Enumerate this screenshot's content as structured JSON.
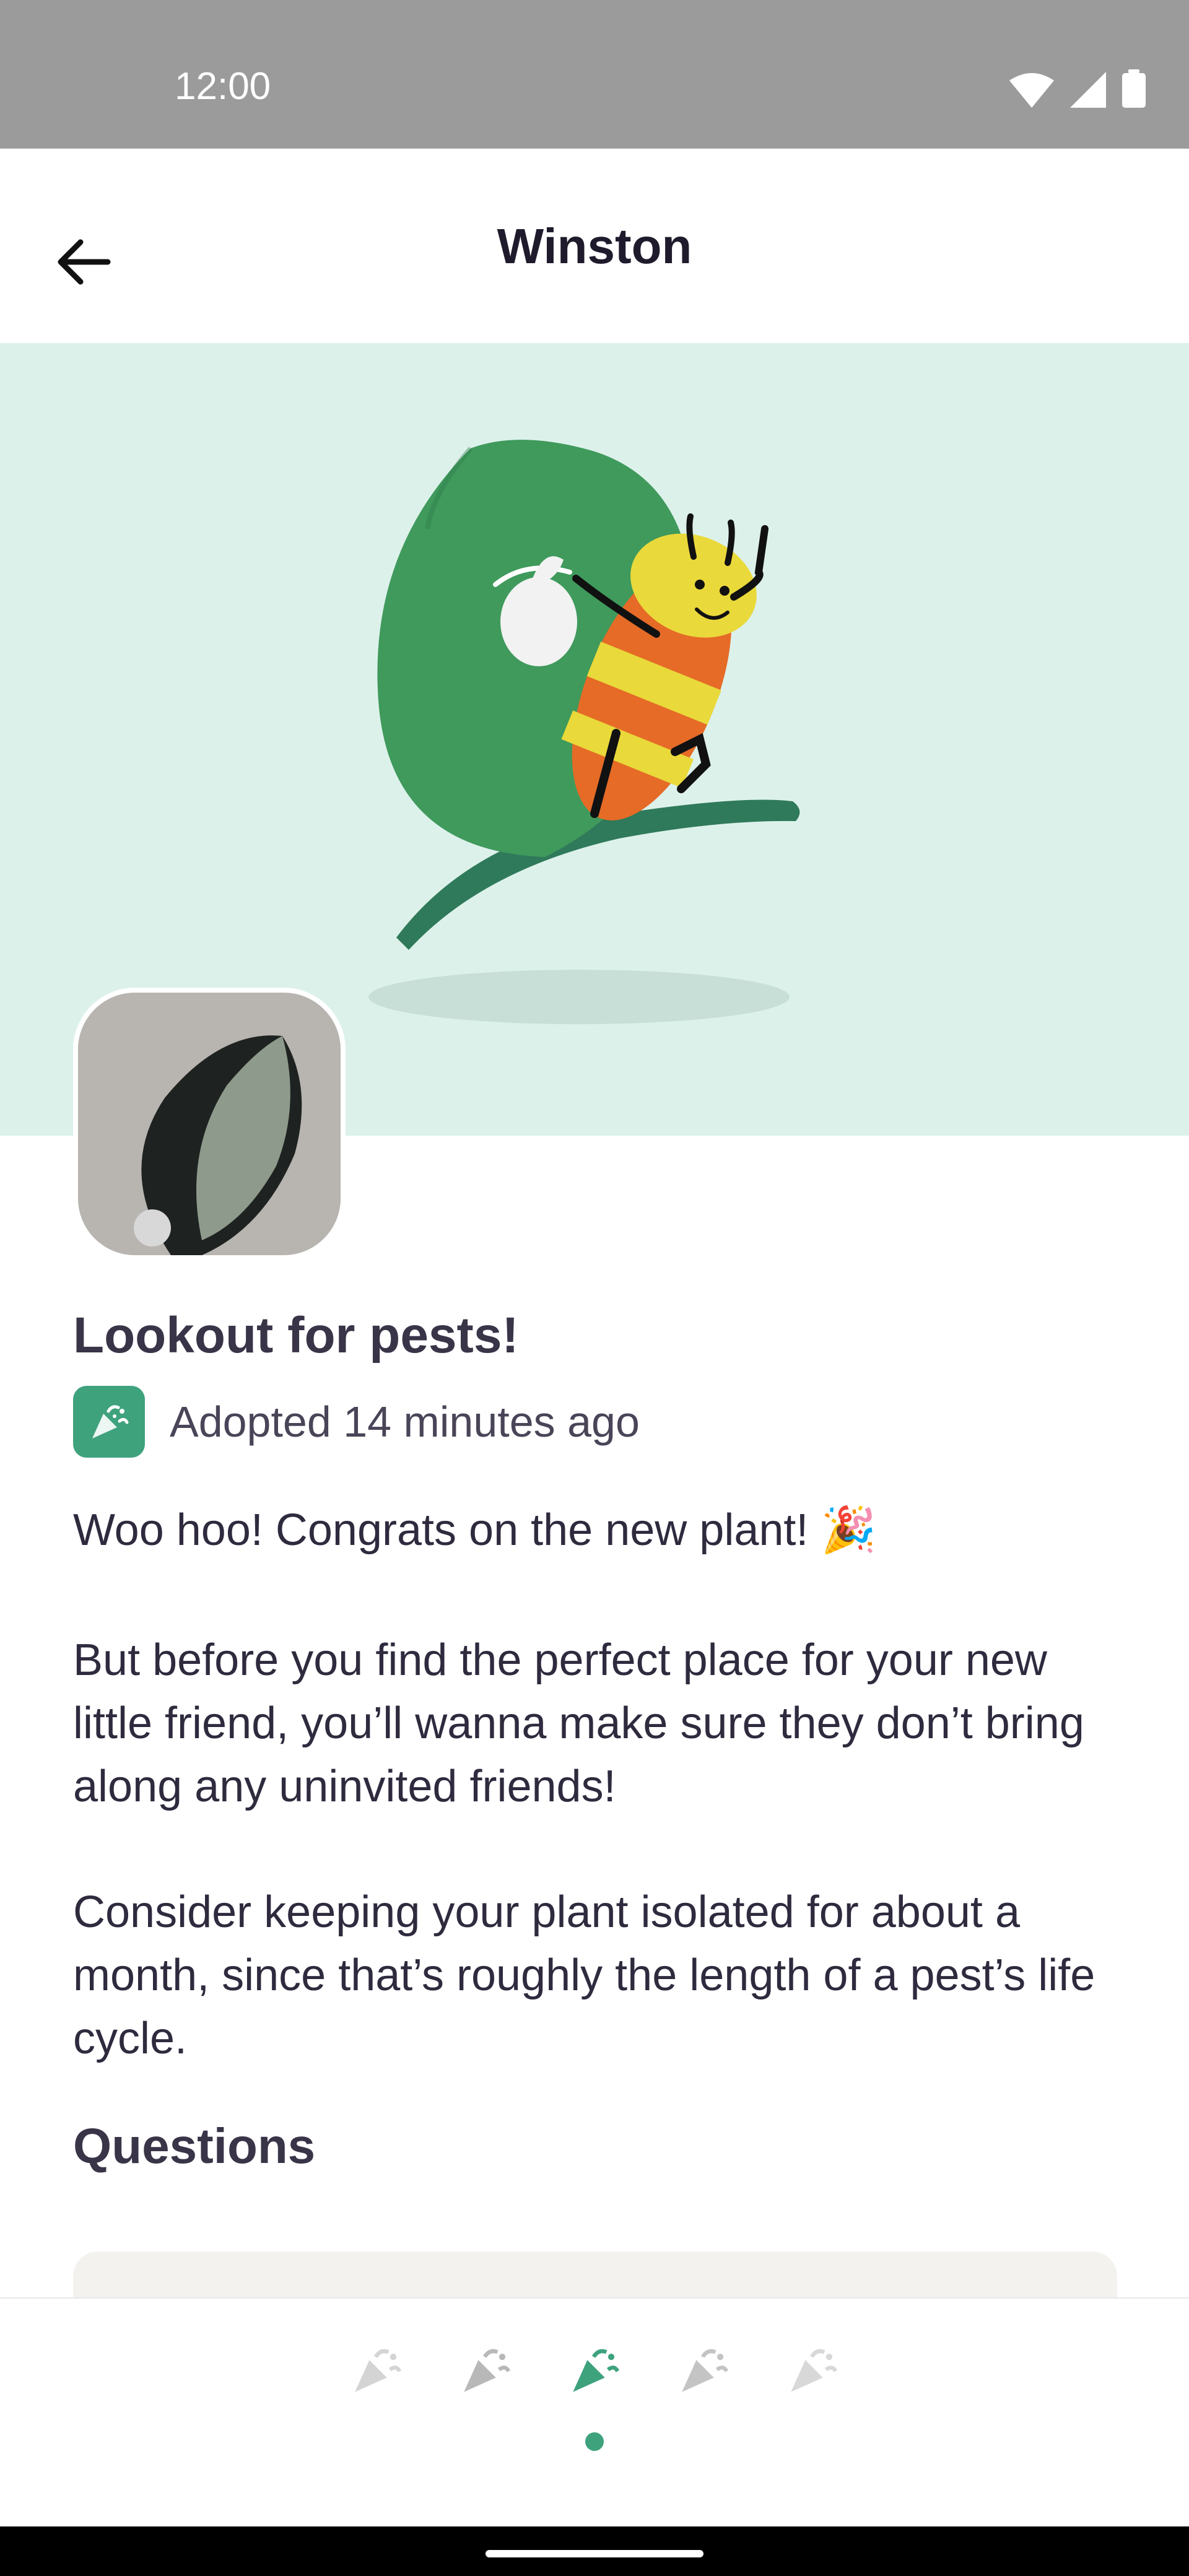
{
  "status_bar": {
    "time": "12:00",
    "icons": [
      "wifi-icon",
      "signal-icon",
      "battery-icon"
    ]
  },
  "header": {
    "title": "Winston",
    "back_icon": "arrow-left-icon"
  },
  "hero": {
    "illustration": "bug-with-bindle-on-leaf",
    "background": "#ddf1eb"
  },
  "plant": {
    "photo": "plant-leaf-photo"
  },
  "content": {
    "heading": "Lookout for pests!",
    "adopted_text": "Adopted 14 minutes ago",
    "paragraph1": "Woo hoo! Congrats on the new plant! 🎉",
    "paragraph2": "But before you find the perfect place for your new little friend, you’ll wanna make sure they don’t bring along any uninvited friends!",
    "paragraph3": "Consider keeping your plant isolated for about a month, since that’s roughly the length of a pest’s life cycle.",
    "questions_label": "Questions"
  },
  "pager": {
    "icons": [
      "party-popper-icon",
      "party-popper-icon",
      "party-popper-icon",
      "party-popper-icon",
      "party-popper-icon"
    ],
    "active_index": 2
  },
  "colors": {
    "accent": "#3ea27d",
    "hero_bg": "#ddf1eb",
    "text": "#2f2a3e"
  }
}
